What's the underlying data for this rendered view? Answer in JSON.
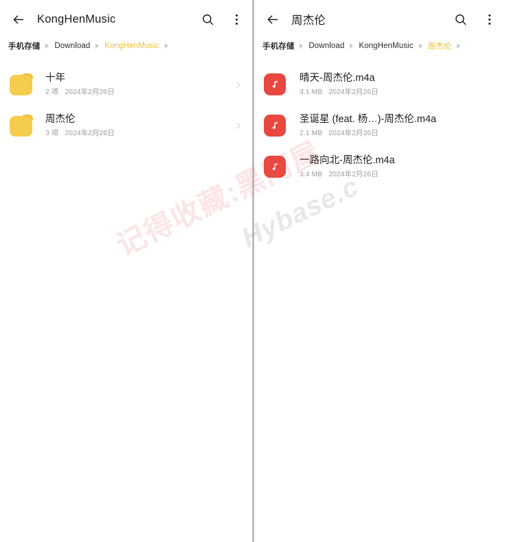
{
  "theme": {
    "accent_gold": "#edc13c",
    "music_icon_red": "#e8483f",
    "folder_icon_yellow": "#f5cd4c",
    "divider_gray": "#bdbdbd",
    "primary_text": "#1c1c1c",
    "secondary_text": "#9b9b9b"
  },
  "left_panel": {
    "appbar": {
      "back_label": "back-arrow",
      "title": "KongHenMusic",
      "search_label": "search-icon",
      "more_label": "more-options-icon"
    },
    "breadcrumb": [
      {
        "label": "手机存储",
        "active": false,
        "root": true
      },
      {
        "label": "Download",
        "active": false,
        "root": false
      },
      {
        "label": "KongHenMusic",
        "active": true,
        "root": false
      }
    ],
    "items": [
      {
        "name": "十年",
        "count": "2 项",
        "date": "2024年2月26日",
        "icon": "folder-icon"
      },
      {
        "name": "周杰伦",
        "count": "3 项",
        "date": "2024年2月26日",
        "icon": "folder-icon"
      }
    ]
  },
  "right_panel": {
    "appbar": {
      "back_label": "back-arrow",
      "title": "周杰伦",
      "search_label": "search-icon",
      "more_label": "more-options-icon"
    },
    "breadcrumb": [
      {
        "label": "手机存储",
        "active": false,
        "root": true
      },
      {
        "label": "Download",
        "active": false,
        "root": false
      },
      {
        "label": "KongHenMusic",
        "active": false,
        "root": false
      },
      {
        "label": "周杰伦",
        "active": true,
        "root": false
      }
    ],
    "items": [
      {
        "name": "晴天-周杰伦.m4a",
        "size": "3.1 MB",
        "date": "2024年2月26日",
        "icon": "music-note-icon"
      },
      {
        "name": "圣诞星 (feat. 杨…)-周杰伦.m4a",
        "size": "2.1 MB",
        "date": "2024年2月26日",
        "icon": "music-note-icon"
      },
      {
        "name": "一路向北-周杰伦.m4a",
        "size": "3.4 MB",
        "date": "2024年2月26日",
        "icon": "music-note-icon"
      }
    ]
  },
  "watermarks": {
    "chinese": "记得收藏:黑阿屋",
    "english": "Hybase.c"
  }
}
